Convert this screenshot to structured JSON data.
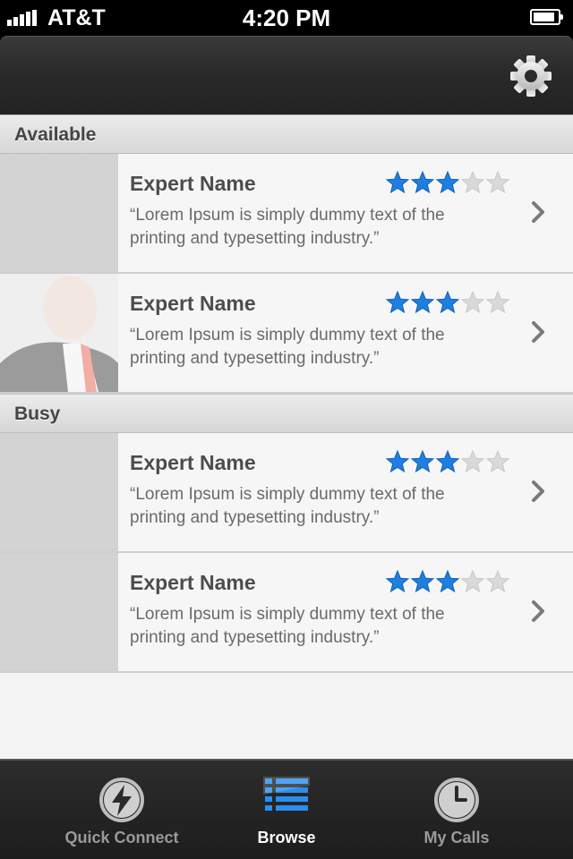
{
  "status_bar": {
    "carrier": "AT&T",
    "time": "4:20 PM",
    "signal_bars": 5,
    "battery_level": 0.9
  },
  "nav_bar": {
    "settings_icon": "gear-icon"
  },
  "sections": [
    {
      "title": "Available",
      "experts": [
        {
          "name": "Expert Name",
          "rating": 3,
          "max_rating": 5,
          "quote": "“Lorem Ipsum is simply dummy text of the printing and typesetting industry.”",
          "has_photo": false
        },
        {
          "name": "Expert Name",
          "rating": 3,
          "max_rating": 5,
          "quote": "“Lorem Ipsum is simply dummy text of the printing and typesetting industry.”",
          "has_photo": true
        }
      ]
    },
    {
      "title": "Busy",
      "experts": [
        {
          "name": "Expert Name",
          "rating": 3,
          "max_rating": 5,
          "quote": "“Lorem Ipsum is simply dummy text of the printing and typesetting industry.”",
          "has_photo": false
        },
        {
          "name": "Expert Name",
          "rating": 3,
          "max_rating": 5,
          "quote": "“Lorem Ipsum is simply dummy text of the printing and typesetting industry.”",
          "has_photo": false
        }
      ]
    }
  ],
  "tab_bar": {
    "tabs": [
      {
        "label": "Quick Connect",
        "icon": "lightning-icon",
        "active": false
      },
      {
        "label": "Browse",
        "icon": "list-icon",
        "active": true
      },
      {
        "label": "My Calls",
        "icon": "clock-icon",
        "active": false
      }
    ]
  },
  "colors": {
    "star_filled": "#1e7fe0",
    "star_empty": "#d9d9d9",
    "tab_active": "#ffffff",
    "tab_inactive": "#9a9a9a",
    "browse_icon": "#2a8ef0"
  }
}
